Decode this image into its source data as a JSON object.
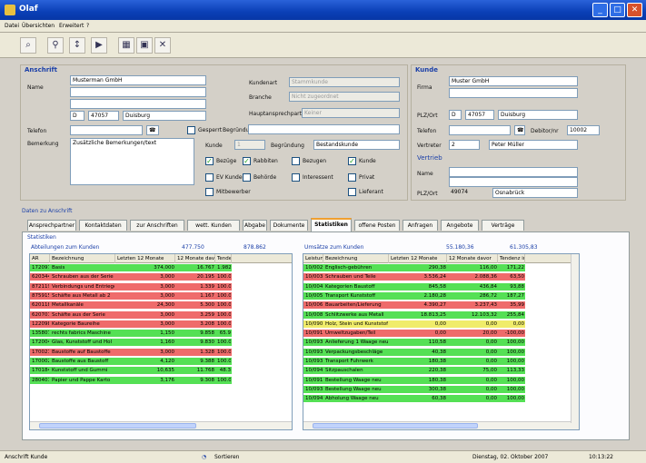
{
  "title": "Olaf",
  "menu": [
    "Datei",
    "Übersichten",
    "Erweitert",
    "?"
  ],
  "toolbar": [
    "search-icon",
    "binoculars-icon",
    "sort-icon",
    "arrow-right-icon",
    "grid-icon",
    "save-icon",
    "delete-icon"
  ],
  "colors": {
    "green": "#55e055",
    "red": "#ef6b6b",
    "yellow": "#f0ec6a"
  },
  "anschrift": {
    "header": "Anschrift",
    "name_label": "Name",
    "name_value": "Musterman GmbH",
    "plz": "D",
    "plz_nr": "47057",
    "city": "Duisburg",
    "telefon_label": "Telefon",
    "bemerkung_label": "Bemerkung",
    "bemerkung_value": "Zusätzliche Bemerkungen/text",
    "kundenart_label": "Kundenart",
    "kundenart_value": "Stammkunde",
    "branche_label": "Branche",
    "branche_value": "Nicht zugeordnet",
    "hauptansprech_label": "Hauptansprechpartner",
    "hauptansprech_value": "Keiner",
    "gesperrt_label": "Gesperrt",
    "begruendung_label": "Begründung",
    "kunde_label": "Kunde",
    "kunde_value": "1",
    "begruendung2_label": "Begründung",
    "begruendung2_value": "Bestandskunde",
    "checks": [
      {
        "label": "Bezüge",
        "checked": true
      },
      {
        "label": "Rabbiten",
        "checked": true
      },
      {
        "label": "Bezugen",
        "checked": false
      },
      {
        "label": "Kunde",
        "checked": true
      },
      {
        "label": "EV Kunde",
        "checked": false
      },
      {
        "label": "Behörde",
        "checked": false
      },
      {
        "label": "Interessent",
        "checked": false
      },
      {
        "label": "Privat",
        "checked": false
      },
      {
        "label": "Mitbewerber",
        "checked": false
      },
      {
        "label": "Lieferant",
        "checked": false
      }
    ]
  },
  "kunde": {
    "header": "Kunde",
    "firma_label": "Firma",
    "firma_value": "Muster GmbH",
    "plz_label": "PLZ/Ort",
    "plz": "D",
    "plz_nr": "47057",
    "city": "Duisburg",
    "telefon_label": "Telefon",
    "nummer_label": "Debitor/nr",
    "nummer_value": "10002",
    "vertreter_label": "Vertreter",
    "vertreter_value": "2",
    "vertreter_name": "Peter Müller",
    "vertrieb_header": "Vertrieb",
    "name_label": "Name",
    "plz2_label": "PLZ/Ort",
    "plz2_nr": "49074",
    "city2": "Osnabrück"
  },
  "daten_label": "Daten zu Anschrift",
  "tabs": [
    "Ansprechpartner",
    "Kontaktdaten",
    "zur Anschriften",
    "wett. Kunden",
    "Abgabe",
    "Dokumente",
    "Statistiken",
    "offene Posten",
    "Anfragen",
    "Angebote",
    "Verträge"
  ],
  "active_tab": 6,
  "stat_label": "Statistiken",
  "left": {
    "header": "Abteilungen zum Kunden",
    "total1": "477.750",
    "total2": "878.862",
    "columns": [
      "AR",
      "Bezeichnung",
      "Letzten 12 Monate",
      "12 Monate davor",
      "Tende"
    ],
    "rows": [
      {
        "c": [
          "172097",
          "Basis",
          "374,000",
          "16.767",
          "1.982"
        ],
        "color": "green"
      },
      {
        "c": [
          "620344",
          "Schrauben aus der Serie",
          "3,000",
          "20.195",
          "100.0"
        ],
        "color": "red"
      },
      {
        "c": [
          "872119",
          "Verbindungs und Entriegel",
          "3,000",
          "1.339",
          "100.0"
        ],
        "color": "red"
      },
      {
        "c": [
          "875915",
          "Schäfte aus Metall ab 2",
          "3,000",
          "1.167",
          "100.0"
        ],
        "color": "red"
      },
      {
        "c": [
          "620118",
          "Metallkanäle",
          "24,300",
          "5.300",
          "100.0"
        ],
        "color": "red"
      },
      {
        "c": [
          "620701",
          "Schäfte aus der Serie",
          "3,000",
          "3.259",
          "100.0"
        ],
        "color": "red"
      },
      {
        "c": [
          "122098",
          "Kategorie Baureihe",
          "3,000",
          "3.208",
          "100.0"
        ],
        "color": "red"
      },
      {
        "c": [
          "135807",
          "rechts fabrics Maschine",
          "1,150",
          "9.858",
          "65.9"
        ],
        "color": "green"
      },
      {
        "c": [
          "172004",
          "Glas, Kunststoff und Hol",
          "1,160",
          "9.830",
          "100.0"
        ],
        "color": "green"
      },
      {
        "c": [
          "170021",
          "Baustoffe auf Baustoffe",
          "3,000",
          "1.328",
          "100.0"
        ],
        "color": "red"
      },
      {
        "c": [
          "170002",
          "Baustoffe aus Baustoff",
          "4,120",
          "9.388",
          "100.0"
        ],
        "color": "green"
      },
      {
        "c": [
          "170184",
          "Kunststoff und Gummi",
          "10,635",
          "11.768",
          "48.3"
        ],
        "color": "green"
      },
      {
        "c": [
          "280401",
          "Papier und Pappe Karto",
          "3,176",
          "9.308",
          "100.0"
        ],
        "color": "green"
      }
    ]
  },
  "right": {
    "header": "Umsätze zum Kunden",
    "total1": "55.180,36",
    "total2": "61.305,83",
    "columns": [
      "Leistung",
      "Bezeichnung",
      "Letzten 12 Monate",
      "12 Monate davor",
      "Tendenz in"
    ],
    "rows": [
      {
        "c": [
          "10/002",
          "Englisch-gebühren",
          "290,38",
          "116,00",
          "171,22"
        ],
        "color": "green"
      },
      {
        "c": [
          "10/003",
          "Schrauben und Teile",
          "3.536,24",
          "2.088,36",
          "63,50"
        ],
        "color": "red"
      },
      {
        "c": [
          "10/004",
          "Kategorien Baustoff",
          "845,58",
          "436,84",
          "93,88"
        ],
        "color": "green"
      },
      {
        "c": [
          "10/005",
          "Transport Kunststoff",
          "2.180,28",
          "286,72",
          "187,27"
        ],
        "color": "green"
      },
      {
        "c": [
          "10/006",
          "Bauarbeiten/Lieferung",
          "4.390,27",
          "3.237,43",
          "35,99"
        ],
        "color": "red"
      },
      {
        "c": [
          "10/008",
          "Schlitzwerke aus Metall",
          "18.813,25",
          "12.103,32",
          "255,84"
        ],
        "color": "green"
      },
      {
        "c": [
          "10/090",
          "Holz, Stein und Kunststoff",
          "0,00",
          "0,00",
          "0,00"
        ],
        "color": "yellow"
      },
      {
        "c": [
          "10/091",
          "Umweltzugaben/Teil",
          "0,00",
          "20,00",
          "-100,00"
        ],
        "color": "red"
      },
      {
        "c": [
          "10/093",
          "Anlieferung 1 Waage neu",
          "110,58",
          "0,00",
          "100,00"
        ],
        "color": "green"
      },
      {
        "c": [
          "10/093",
          "Verpackungsbeschläge",
          "40,38",
          "0,00",
          "100,00"
        ],
        "color": "green"
      },
      {
        "c": [
          "10/093",
          "Transport Fuhrwerk",
          "180,38",
          "0,00",
          "100,00"
        ],
        "color": "green"
      },
      {
        "c": [
          "10/094",
          "Sitzpauschalen",
          "220,38",
          "75,00",
          "113,33"
        ],
        "color": "green"
      },
      {
        "c": [
          "10/091",
          "Bestellung Waage neu",
          "180,38",
          "0,00",
          "100,00"
        ],
        "color": "green"
      },
      {
        "c": [
          "10/093",
          "Bestellung Waage neu",
          "300,38",
          "0,00",
          "100,00"
        ],
        "color": "green"
      },
      {
        "c": [
          "10/094",
          "Abholung Waage neu",
          "60,38",
          "0,00",
          "100,00"
        ],
        "color": "green"
      }
    ]
  },
  "status": {
    "left": "Anschrift Kunde",
    "mid": "Sortieren",
    "date": "Dienstag, 02. Oktober 2007",
    "time": "10:13:22"
  }
}
